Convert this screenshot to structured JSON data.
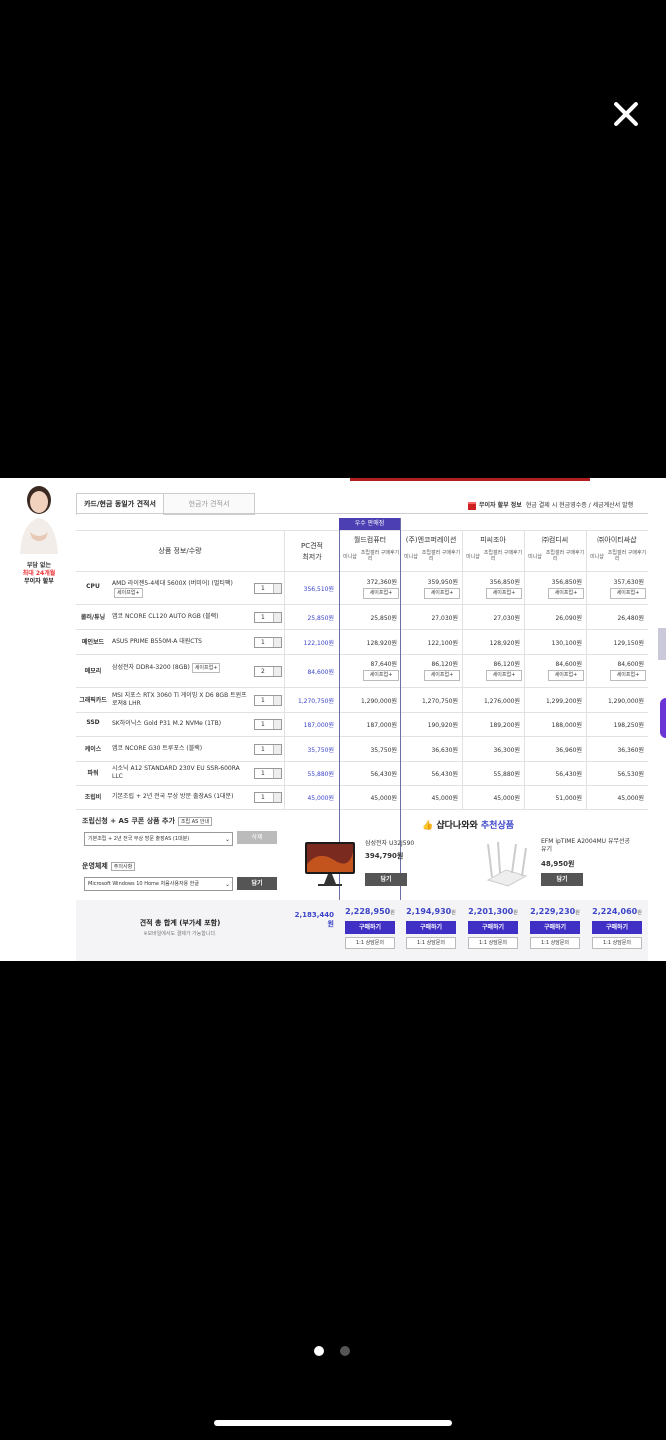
{
  "close_label": "✕",
  "promo": {
    "line1": "부담 없는",
    "line2": "최대 24개월",
    "line3": "무이자 할부"
  },
  "tabs": {
    "active": "카드/현금 동일가 견적서",
    "inactive": "현금가 견적서"
  },
  "notice": {
    "title": "무이자 할부 정보",
    "text": "현금 결제 시 현금영수증 / 세금계산서 발행"
  },
  "header": {
    "product_info": "상품 정보/수량",
    "pc_lowest_1": "PC견적",
    "pc_lowest_2": "최저가",
    "badge": "우수 판매점",
    "sellers": [
      "월드컴퓨터",
      "(주)엔코퍼레이션",
      "피씨조아",
      "㈜컴디씨",
      "㈜아이티싸샵"
    ],
    "sub": [
      "미니샵",
      "조립갤러리",
      "구매후기"
    ]
  },
  "popup_label": "세이프업+",
  "rows": [
    {
      "cat": "CPU",
      "name": "AMD 라이젠5-4세대 5600X (버미어) (멀티팩)",
      "tag": "세이프업+",
      "qty": "1",
      "lowest": "356,510원",
      "prices": [
        "372,360원",
        "359,950원",
        "356,850원",
        "356,850원",
        "357,630원"
      ]
    },
    {
      "cat": "쿨러/튜닝",
      "name": "앱코 NCORE CL120 AUTO RGB (블랙)",
      "tag": "",
      "qty": "1",
      "lowest": "25,850원",
      "prices": [
        "25,850원",
        "27,030원",
        "27,030원",
        "26,090원",
        "26,480원"
      ]
    },
    {
      "cat": "메인보드",
      "name": "ASUS PRIME B550M-A 대원CTS",
      "tag": "",
      "qty": "1",
      "lowest": "122,100원",
      "prices": [
        "128,920원",
        "122,100원",
        "128,920원",
        "130,100원",
        "129,150원"
      ]
    },
    {
      "cat": "메모리",
      "name": "삼성전자 DDR4-3200 (8GB)",
      "tag": "세이프업+",
      "qty": "2",
      "lowest": "84,600원",
      "prices": [
        "87,640원",
        "86,120원",
        "86,120원",
        "84,600원",
        "84,600원"
      ]
    },
    {
      "cat": "그래픽카드",
      "name": "MSI 지포스 RTX 3060 Ti 게이밍 X D6 8GB 트윈프로져8 LHR",
      "tag": "",
      "qty": "1",
      "lowest": "1,270,750원",
      "prices": [
        "1,290,000원",
        "1,270,750원",
        "1,276,000원",
        "1,299,200원",
        "1,290,000원"
      ]
    },
    {
      "cat": "SSD",
      "name": "SK하이닉스 Gold P31 M.2 NVMe (1TB)",
      "tag": "",
      "qty": "1",
      "lowest": "187,000원",
      "prices": [
        "187,000원",
        "190,920원",
        "189,200원",
        "188,000원",
        "198,250원"
      ]
    },
    {
      "cat": "케이스",
      "name": "앱코 NCORE G30 트루포스 (블랙)",
      "tag": "",
      "qty": "1",
      "lowest": "35,750원",
      "prices": [
        "35,750원",
        "36,630원",
        "36,300원",
        "36,960원",
        "36,360원"
      ]
    },
    {
      "cat": "파워",
      "name": "시소닉 A12 STANDARD 230V EU SSR-600RA LLC",
      "tag": "",
      "qty": "1",
      "lowest": "55,880원",
      "prices": [
        "56,430원",
        "56,430원",
        "55,880원",
        "56,430원",
        "56,530원"
      ]
    },
    {
      "cat": "조립비",
      "name": "기본조립 + 2년 전국 무상 방문 출장AS (1대분)",
      "tag": "",
      "qty": "1",
      "lowest": "45,000원",
      "prices": [
        "45,000원",
        "45,000원",
        "45,000원",
        "51,000원",
        "45,000원"
      ]
    }
  ],
  "assembly": {
    "label": "조립신청 + AS 쿠폰 상품 추가",
    "mini": "조립 AS 안내",
    "select": "기본조립 + 2년 전국 무상 방문 출장AS (1대분)",
    "delete": "삭제"
  },
  "os": {
    "label": "운영체제",
    "mini": "주의사항",
    "select": "Microsoft Windows 10 Home 처음사용자용 한글",
    "add": "담기"
  },
  "reco": {
    "prefix": "샵다나와",
    "accent": "추천상품",
    "items": [
      {
        "name": "삼성전자 U32J590",
        "price": "394,790원",
        "add": "담기"
      },
      {
        "name": "EFM ipTIME A2004MU 유무선공유기",
        "price": "48,950원",
        "add": "담기"
      }
    ]
  },
  "totals": {
    "label": "견적 총 합계 (부가세 포함)",
    "sub": "※모바일에서도 결제가 가능합니다.",
    "lowest": "2,183,440원",
    "prices": [
      "2,228,950",
      "2,194,930",
      "2,201,300",
      "2,229,230",
      "2,224,060"
    ],
    "won": "원",
    "buy": "구매하기",
    "ask": "1:1 상담문의"
  },
  "pager": {
    "count": 2,
    "active": 0
  },
  "colors": {
    "accent": "#3c44c8",
    "buy": "#3f2fc4",
    "badge": "#4b3fb3"
  }
}
